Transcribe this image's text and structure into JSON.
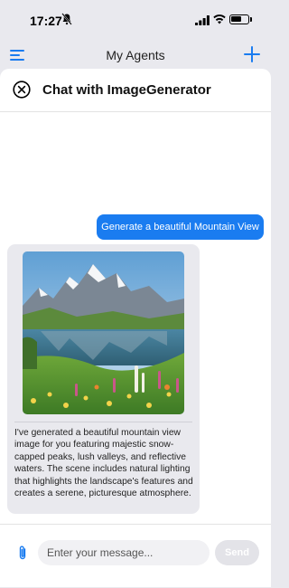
{
  "status_bar": {
    "time": "17:27"
  },
  "background_header": {
    "title": "My Agents"
  },
  "sheet": {
    "title": "Chat with ImageGenerator"
  },
  "messages": {
    "user": "Generate a beautiful Mountain View",
    "assistant": "I've generated a beautiful mountain view image for you featuring majestic snow-capped peaks, lush valleys, and reflective waters. The scene includes natural lighting that highlights the landscape's features and creates a serene, picturesque atmosphere."
  },
  "composer": {
    "placeholder": "Enter your message...",
    "send_label": "Send"
  },
  "icons": [
    "bell-slash-icon",
    "signal-icon",
    "wifi-icon",
    "battery-icon",
    "menu-icon",
    "plus-icon",
    "close-icon",
    "paperclip-icon"
  ],
  "colors": {
    "accent": "#1a7cf0",
    "assistant_bubble": "#e9e9ee",
    "send_disabled": "#e3e3e8"
  }
}
